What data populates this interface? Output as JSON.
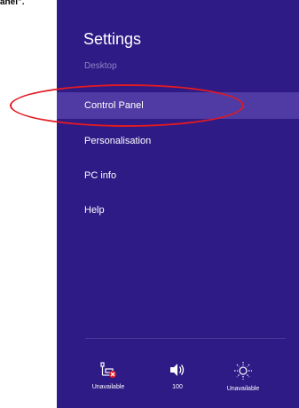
{
  "caption": "anel\".",
  "settings": {
    "title": "Settings",
    "subtitle": "Desktop",
    "items": [
      {
        "label": "Control Panel"
      },
      {
        "label": "Personalisation"
      },
      {
        "label": "PC info"
      },
      {
        "label": "Help"
      }
    ]
  },
  "quick_settings": [
    {
      "icon": "network-unavailable-icon",
      "label": "Unavailable"
    },
    {
      "icon": "volume-icon",
      "label": "100"
    },
    {
      "icon": "brightness-icon",
      "label": "Unavailable"
    }
  ],
  "colors": {
    "panel": "#2f1b86",
    "active_item": "#4f3ba3",
    "highlight_ellipse": "#e11a22",
    "subtitle": "#8e86c2"
  }
}
